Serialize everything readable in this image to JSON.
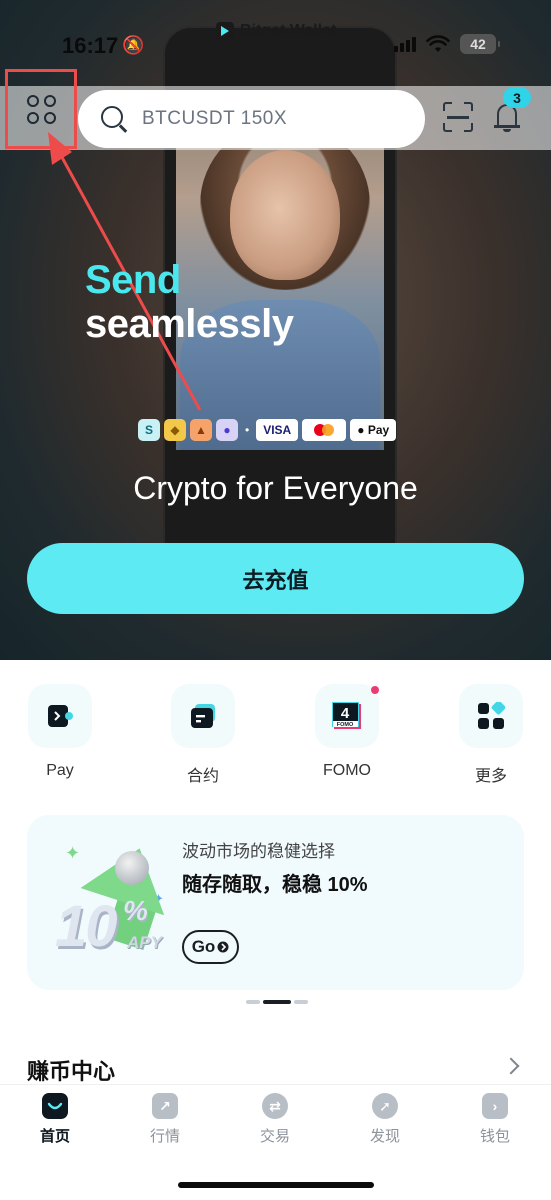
{
  "status_bar": {
    "time": "16:17",
    "app_name": "Bitget Wallet",
    "battery": "42"
  },
  "header": {
    "search_placeholder": "BTCUSDT 150X",
    "notification_count": "3"
  },
  "hero": {
    "headline_1": "Send",
    "headline_2": "seamlessly",
    "payment_methods": [
      "VISA",
      "Pay"
    ],
    "tagline": "Crypto for Everyone",
    "cta_label": "去充值"
  },
  "quick_actions": [
    {
      "label": "Pay"
    },
    {
      "label": "合约"
    },
    {
      "label": "FOMO",
      "badge_text": "4",
      "sub_text": "FOMO"
    },
    {
      "label": "更多"
    }
  ],
  "promo": {
    "subtitle": "波动市场的稳健选择",
    "title": "随存随取，稳稳 10%",
    "button": "Go",
    "art_number": "10",
    "art_percent": "%",
    "art_apy": "APY"
  },
  "section": {
    "title": "赚币中心"
  },
  "tabs": [
    {
      "label": "首页",
      "active": true
    },
    {
      "label": "行情"
    },
    {
      "label": "交易"
    },
    {
      "label": "发现"
    },
    {
      "label": "钱包"
    }
  ],
  "colors": {
    "accent": "#5eeaf2",
    "annotation": "#ee4b4b",
    "active_tab": "#0e1820"
  }
}
